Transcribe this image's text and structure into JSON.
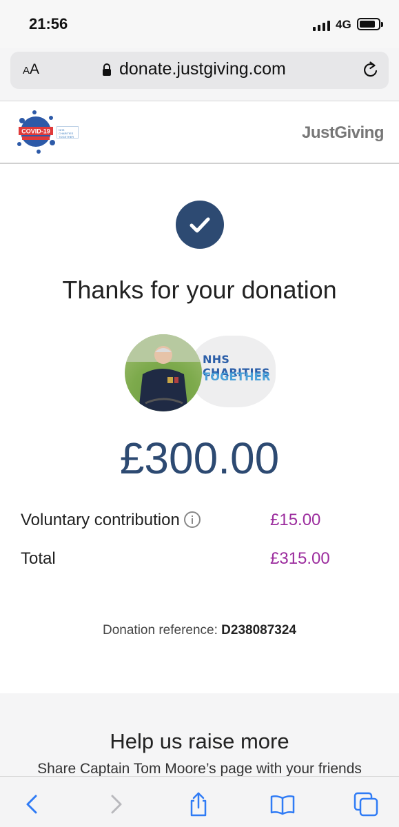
{
  "status_bar": {
    "time": "21:56",
    "network": "4G",
    "icons": [
      "signal-icon",
      "battery-icon"
    ]
  },
  "browser": {
    "text_size_label": "AA",
    "url": "donate.justgiving.com",
    "icons": [
      "lock-icon",
      "reload-icon"
    ]
  },
  "site_header": {
    "campaign_logo_text": "COVID-19",
    "partner_logo_text": "NHS CHARITIES TOGETHER",
    "brand": "JustGiving"
  },
  "confirmation": {
    "heading": "Thanks for your donation",
    "charity_logo_line1": "NHS CHARITIES",
    "charity_logo_line2": "TOGETHER",
    "amount": "£300.00",
    "voluntary_label": "Voluntary contribution",
    "voluntary_value": "£15.00",
    "total_label": "Total",
    "total_value": "£315.00",
    "reference_label": "Donation reference:",
    "reference_value": "D238087324"
  },
  "promo": {
    "heading": "Help us raise more",
    "subtext": "Share Captain Tom Moore’s page with your friends"
  },
  "toolbar": {
    "icons": [
      "back-icon",
      "forward-icon",
      "share-icon",
      "bookmarks-icon",
      "tabs-icon"
    ]
  },
  "colors": {
    "accent": "#2d4a72",
    "price": "#9c2d9e",
    "brand_grey": "#777777"
  }
}
